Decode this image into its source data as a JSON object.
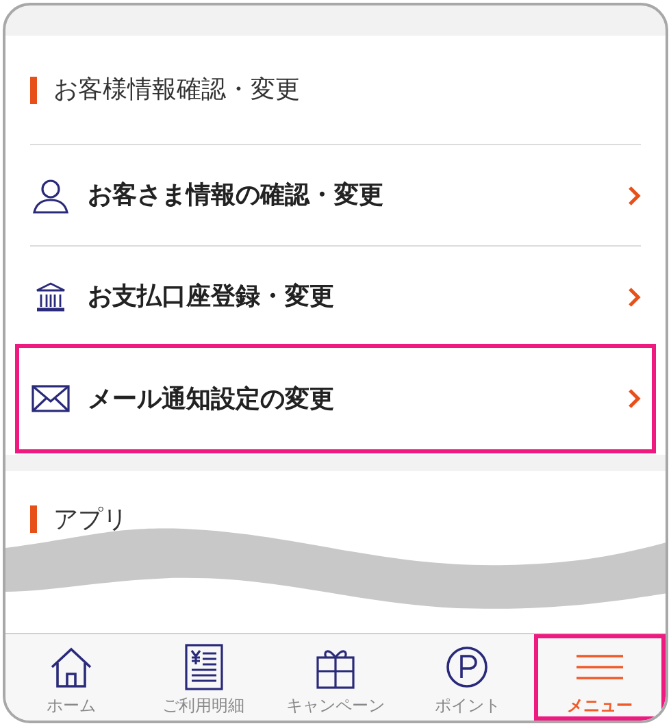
{
  "section": {
    "title": "お客様情報確認・変更"
  },
  "items": [
    {
      "kind": "person",
      "label": "お客さま情報の確認・変更",
      "highlighted": false
    },
    {
      "kind": "bank",
      "label": "お支払口座登録・変更",
      "highlighted": false
    },
    {
      "kind": "mail",
      "label": "メール通知設定の変更",
      "highlighted": true
    }
  ],
  "next_section": {
    "title": "アプリ"
  },
  "tabs": [
    {
      "kind": "home",
      "label": "ホーム",
      "selected": false
    },
    {
      "kind": "statement",
      "label": "ご利用明細",
      "selected": false
    },
    {
      "kind": "gift",
      "label": "キャンペーン",
      "selected": false
    },
    {
      "kind": "point",
      "label": "ポイント",
      "selected": false
    },
    {
      "kind": "menu",
      "label": "メニュー",
      "selected": true
    }
  ]
}
